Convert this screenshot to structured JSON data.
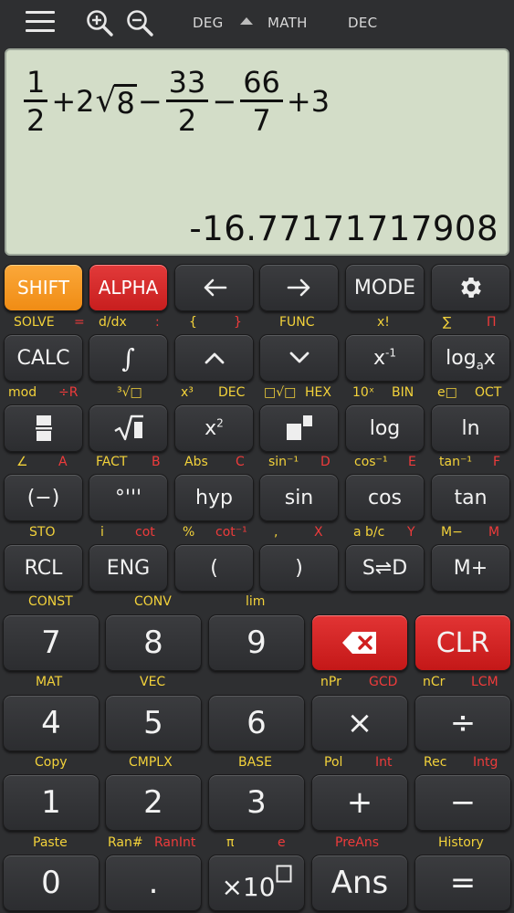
{
  "status": {
    "angle": "DEG",
    "mode": "MATH",
    "base": "DEC"
  },
  "display": {
    "expr": {
      "f1_num": "1",
      "f1_den": "2",
      "plus1": "+2",
      "sqrt_arg": "8",
      "minus1": "−",
      "f2_num": "33",
      "f2_den": "2",
      "minus2": "−",
      "f3_num": "66",
      "f3_den": "7",
      "plus_end": "+3"
    },
    "result": "-16.77171717908"
  },
  "keys": {
    "shift": "SHIFT",
    "alpha": "ALPHA",
    "mode": "MODE",
    "calc": "CALC",
    "log": "log",
    "ln": "ln",
    "neg": "(−)",
    "dms": "°'''",
    "hyp": "hyp",
    "sin": "sin",
    "cos": "cos",
    "tan": "tan",
    "rcl": "RCL",
    "eng": "ENG",
    "lparen": "(",
    "rparen": ")",
    "sd": "S⇌D",
    "mplus": "M+",
    "d7": "7",
    "d8": "8",
    "d9": "9",
    "clr": "CLR",
    "d4": "4",
    "d5": "5",
    "d6": "6",
    "mul": "×",
    "div": "÷",
    "d1": "1",
    "d2": "2",
    "d3": "3",
    "add": "+",
    "sub": "−",
    "d0": "0",
    "dot": ".",
    "ans": "Ans",
    "eq": "="
  },
  "labels": {
    "solve": "SOLVE",
    "eq_small": "=",
    "ddx": "d/dx",
    "colon": ":",
    "lbrace": "{",
    "rbrace": "}",
    "func": "FUNC",
    "fact_x": "x!",
    "sigma": "∑",
    "pi_prod": "Π",
    "mod": "mod",
    "divr": "÷R",
    "cbrt": "³√□",
    "x3": "x³",
    "dec": "DEC",
    "nroot": "□√□",
    "hex": "HEX",
    "tenx": "10ˣ",
    "bin": "BIN",
    "ex": "e□",
    "oct": "OCT",
    "angle": "∠",
    "a": "A",
    "fact": "FACT",
    "b": "B",
    "abs": "Abs",
    "c": "C",
    "asin": "sin⁻¹",
    "d": "D",
    "acos": "cos⁻¹",
    "e": "E",
    "atan": "tan⁻¹",
    "f": "F",
    "sto": "STO",
    "i": "i",
    "cot": "cot",
    "pct": "%",
    "acot": "cot⁻¹",
    "comma": ",",
    "x": "X",
    "abc": "a b/c",
    "y": "Y",
    "mminus": "M−",
    "m": "M",
    "const": "CONST",
    "conv": "CONV",
    "lim": "lim",
    "mat": "MAT",
    "vec": "VEC",
    "npr": "nPr",
    "gcd": "GCD",
    "ncr": "nCr",
    "lcm": "LCM",
    "copy": "Copy",
    "cmplx": "CMPLX",
    "base": "BASE",
    "pol": "Pol",
    "int": "Int",
    "rec": "Rec",
    "intg": "Intg",
    "paste": "Paste",
    "ran": "Ran#",
    "ranint": "RanInt",
    "pi": "π",
    "e_const": "e",
    "preans": "PreAns",
    "history": "History"
  },
  "colors": {
    "shift": "#f7a02a",
    "alpha": "#d72b2b",
    "display": "#d3ddc8",
    "yellow_label": "#f3d23a",
    "red_label": "#ee3b3b"
  }
}
